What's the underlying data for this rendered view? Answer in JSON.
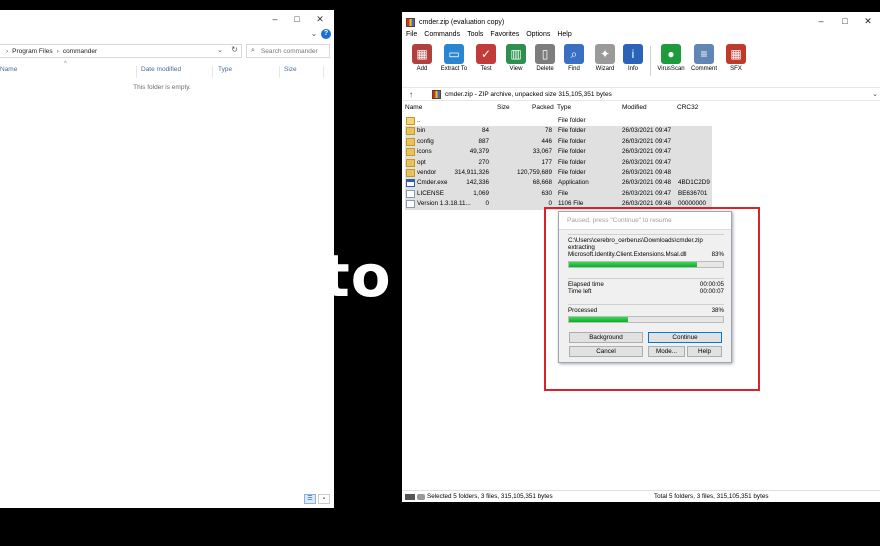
{
  "explorer": {
    "breadcrumb": [
      "Program Files",
      "commander"
    ],
    "search_placeholder": "Search commander",
    "columns": [
      "Name",
      "Date modified",
      "Type",
      "Size"
    ],
    "empty_message": "This folder is empty."
  },
  "background_text": "to",
  "winrar": {
    "title": "cmder.zip (evaluation copy)",
    "menu": [
      "File",
      "Commands",
      "Tools",
      "Favorites",
      "Options",
      "Help"
    ],
    "toolbar": [
      {
        "label": "Add",
        "icon": "add-archive-icon",
        "color": "#b0413e"
      },
      {
        "label": "Extract To",
        "icon": "extract-folder-icon",
        "color": "#2a86d1"
      },
      {
        "label": "Test",
        "icon": "test-check-icon",
        "color": "#c23b3b"
      },
      {
        "label": "View",
        "icon": "view-book-icon",
        "color": "#2f8f4e"
      },
      {
        "label": "Delete",
        "icon": "trash-icon",
        "color": "#7d7d7d"
      },
      {
        "label": "Find",
        "icon": "magnifier-icon",
        "color": "#3a6fc4"
      },
      {
        "label": "Wizard",
        "icon": "magic-wand-icon",
        "color": "#9a9a9a"
      },
      {
        "label": "Info",
        "icon": "info-icon",
        "color": "#2b63b8"
      },
      {
        "label": "VirusScan",
        "icon": "virus-scan-icon",
        "color": "#1e9b3c"
      },
      {
        "label": "Comment",
        "icon": "comment-icon",
        "color": "#5f86b5"
      },
      {
        "label": "SFX",
        "icon": "sfx-icon",
        "color": "#c0392b"
      }
    ],
    "path": "cmder.zip - ZIP archive, unpacked size 315,105,351 bytes",
    "columns": {
      "name": "Name",
      "size": "Size",
      "packed": "Packed",
      "type": "Type",
      "modified": "Modified",
      "crc": "CRC32"
    },
    "files": [
      {
        "name": "..",
        "size": "",
        "packed": "",
        "type": "File folder",
        "modified": "",
        "crc": "",
        "icon": "updir"
      },
      {
        "name": "bin",
        "size": "84",
        "packed": "78",
        "type": "File folder",
        "modified": "26/03/2021 09:47",
        "crc": "",
        "icon": "folder"
      },
      {
        "name": "config",
        "size": "887",
        "packed": "446",
        "type": "File folder",
        "modified": "26/03/2021 09:47",
        "crc": "",
        "icon": "folder"
      },
      {
        "name": "icons",
        "size": "49,379",
        "packed": "33,067",
        "type": "File folder",
        "modified": "26/03/2021 09:47",
        "crc": "",
        "icon": "folder"
      },
      {
        "name": "opt",
        "size": "270",
        "packed": "177",
        "type": "File folder",
        "modified": "26/03/2021 09:47",
        "crc": "",
        "icon": "folder"
      },
      {
        "name": "vendor",
        "size": "314,911,326",
        "packed": "120,759,689",
        "type": "File folder",
        "modified": "26/03/2021 09:48",
        "crc": "",
        "icon": "folder"
      },
      {
        "name": "Cmder.exe",
        "size": "142,336",
        "packed": "68,668",
        "type": "Application",
        "modified": "26/03/2021 09:48",
        "crc": "4BD1C2D9",
        "icon": "exe"
      },
      {
        "name": "LICENSE",
        "size": "1,069",
        "packed": "630",
        "type": "File",
        "modified": "26/03/2021 09:47",
        "crc": "BE636701",
        "icon": "file"
      },
      {
        "name": "Version 1.3.18.11...",
        "size": "0",
        "packed": "0",
        "type": "1106 File",
        "modified": "26/03/2021 09:48",
        "crc": "00000000",
        "icon": "file"
      }
    ],
    "status_left": "Selected 5 folders, 3 files, 315,105,351 bytes",
    "status_right": "Total 5 folders, 3 files, 315,105,351 bytes"
  },
  "dialog": {
    "title": "Paused, press \"Continue\" to resume",
    "archive_path": "C:\\Users\\cerebro_cerberus\\Downloads\\cmder.zip",
    "action": "extracting",
    "current_file": "Microsoft.Identity.Client.Extensions.Msal.dll",
    "file_percent": "83%",
    "file_progress": 0.83,
    "elapsed_label": "Elapsed time",
    "elapsed_value": "00:00:05",
    "left_label": "Time left",
    "left_value": "00:00:07",
    "processed_label": "Processed",
    "processed_percent": "38%",
    "processed_progress": 0.38,
    "buttons": {
      "background": "Background",
      "continue": "Continue",
      "cancel": "Cancel",
      "mode": "Mode...",
      "help": "Help"
    }
  }
}
